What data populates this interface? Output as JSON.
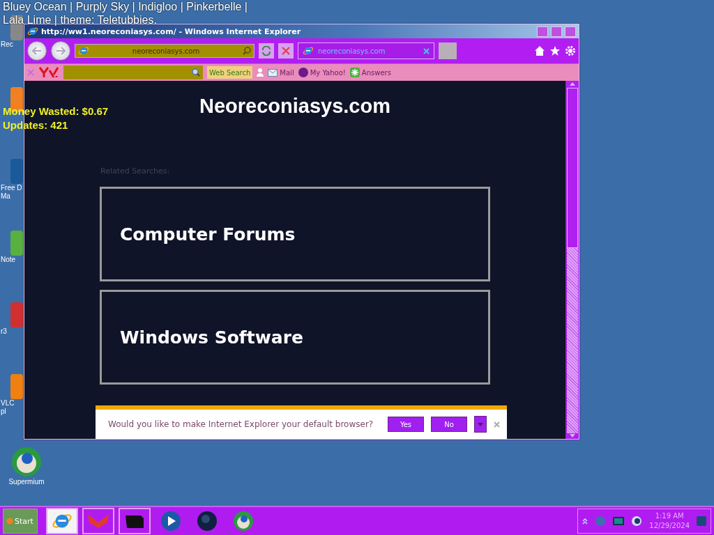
{
  "theme_banner": [
    "Bluey Ocean | Purply Sky | Indigloo | Pinkerbelle |",
    "Lala Lime | theme: Teletubbies."
  ],
  "stats": [
    "Money Wasted: $0.67",
    "Updates: 421"
  ],
  "desktop_icons": [
    {
      "kind": "recycle",
      "label": [
        "Rec"
      ]
    },
    {
      "kind": "orange"
    },
    {
      "kind": "document",
      "label": [
        "Free D",
        "Ma"
      ]
    },
    {
      "kind": "notepad",
      "label": [
        "Note"
      ]
    },
    {
      "kind": "red",
      "label": [
        "r3"
      ]
    },
    {
      "kind": "vlc",
      "label": [
        "VLC",
        "pl"
      ]
    },
    {
      "kind": "supermium",
      "label": [
        "Supermium"
      ]
    }
  ],
  "window": {
    "title": "http://ww1.neoreconiasys.com/ - Windows Internet Explorer",
    "address": "neoreconiasys.com",
    "tabs": [
      {
        "label": "neoreconiasys.com",
        "selected": true
      }
    ],
    "yahoo_toolbar": {
      "search_button": "Web Search",
      "links": [
        {
          "kind": "mail",
          "label": "Mail"
        },
        {
          "kind": "my",
          "label": "My Yahoo!"
        },
        {
          "kind": "answers",
          "label": "Answers"
        }
      ]
    }
  },
  "page": {
    "title": "Neoreconiasys.com",
    "related_label": "Related Searches:",
    "results": [
      "Computer Forums",
      "Windows Software"
    ]
  },
  "infobar": {
    "message": "Would you like to make Internet Explorer your default browser?",
    "buttons": [
      "Yes",
      "No"
    ]
  },
  "taskbar": {
    "start": "Start",
    "apps": [
      {
        "kind": "ie",
        "selected": true,
        "open": true
      },
      {
        "kind": "fox",
        "selected": false,
        "open": true
      },
      {
        "kind": "box",
        "selected": false,
        "open": true
      },
      {
        "kind": "player",
        "selected": false,
        "open": false
      },
      {
        "kind": "globe",
        "selected": false,
        "open": false
      },
      {
        "kind": "supermium",
        "selected": false,
        "open": false
      }
    ],
    "clock": {
      "time": "1:19 AM",
      "date": "12/29/2024"
    }
  }
}
